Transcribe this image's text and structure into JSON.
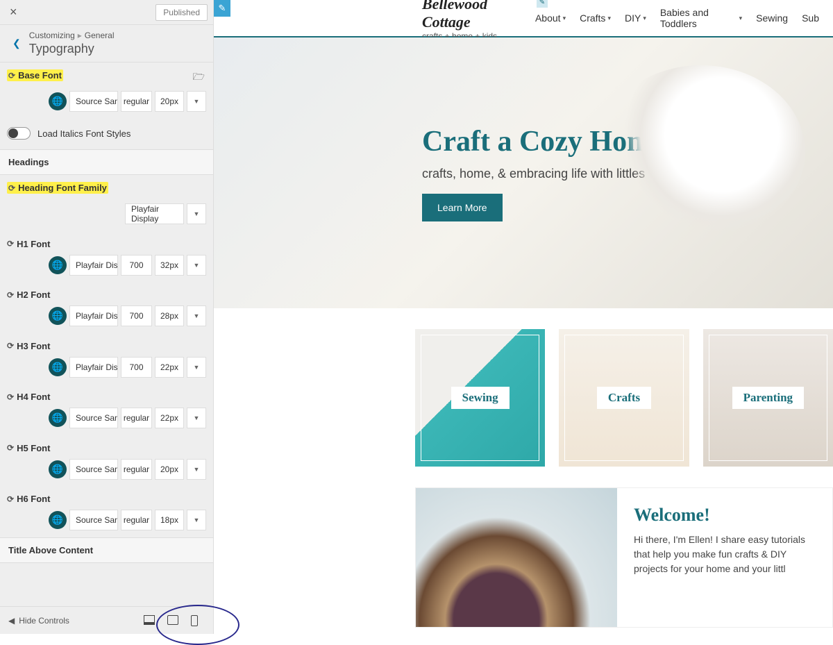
{
  "sidebar": {
    "close": "×",
    "published": "Published",
    "breadcrumb": {
      "customizing": "Customizing",
      "general": "General"
    },
    "title": "Typography",
    "base_font": {
      "label": "Base Font",
      "family": "Source Sans Pro",
      "weight": "regular",
      "size": "20px"
    },
    "load_italics": "Load Italics Font Styles",
    "headings_section": "Headings",
    "heading_font_family": {
      "label": "Heading Font Family",
      "family": "Playfair Display"
    },
    "h": [
      {
        "label": "H1 Font",
        "family": "Playfair Display",
        "weight": "700",
        "size": "32px"
      },
      {
        "label": "H2 Font",
        "family": "Playfair Display",
        "weight": "700",
        "size": "28px"
      },
      {
        "label": "H3 Font",
        "family": "Playfair Display",
        "weight": "700",
        "size": "22px"
      },
      {
        "label": "H4 Font",
        "family": "Source Sans Pro",
        "weight": "regular",
        "size": "22px"
      },
      {
        "label": "H5 Font",
        "family": "Source Sans Pro",
        "weight": "regular",
        "size": "20px"
      },
      {
        "label": "H6 Font",
        "family": "Source Sans Pro",
        "weight": "regular",
        "size": "18px"
      }
    ],
    "title_above_content": "Title Above Content",
    "hide_controls": "Hide Controls"
  },
  "preview": {
    "brand_title": "Bellewood Cottage",
    "brand_tag": "crafts + home + kids",
    "nav": [
      "About",
      "Crafts",
      "DIY",
      "Babies and Toddlers",
      "Sewing",
      "Sub"
    ],
    "hero": {
      "title": "Craft a Cozy Home",
      "subtitle": "crafts, home, & embracing life with littles",
      "cta": "Learn More"
    },
    "cards": [
      "Sewing",
      "Crafts",
      "Parenting"
    ],
    "welcome": {
      "title": "Welcome!",
      "body": "Hi there, I'm Ellen! I share easy tutorials that help you make fun crafts & DIY projects for your home and your littl"
    }
  }
}
